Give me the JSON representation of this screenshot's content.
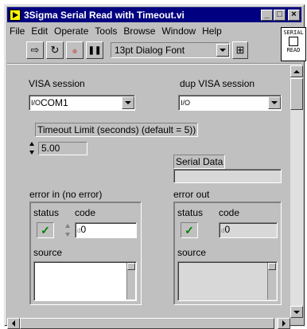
{
  "window": {
    "title": "3Sigma Serial Read with Timeout.vi",
    "min_glyph": "_",
    "max_glyph": "□",
    "close_glyph": "×"
  },
  "menu": [
    "File",
    "Edit",
    "Operate",
    "Tools",
    "Browse",
    "Window",
    "Help"
  ],
  "toolbar": {
    "run_icon": "⇨",
    "run_cont_icon": "↻",
    "abort_icon": "●",
    "pause_icon": "❚❚",
    "font": "13pt Dialog Font",
    "align_icon": "⊞"
  },
  "connector": {
    "line1": "SERIAL",
    "line2": "READ"
  },
  "controls": {
    "visa_session": {
      "label": "VISA session",
      "icon": "I/O",
      "value": "COM1"
    },
    "dup_visa": {
      "label": "dup VISA session",
      "icon": "I/O",
      "value": ""
    },
    "timeout": {
      "label": "Timeout Limit (seconds) (default = 5))",
      "value": "5.00"
    },
    "serial_data": {
      "label": "Serial Data",
      "value": ""
    },
    "error_in": {
      "label": "error in (no error)",
      "status_label": "status",
      "status_glyph": "✓",
      "code_label": "code",
      "code_value": "0",
      "code_prefix": "d",
      "source_label": "source",
      "source_value": ""
    },
    "error_out": {
      "label": "error out",
      "status_label": "status",
      "status_glyph": "✓",
      "code_label": "code",
      "code_value": "0",
      "code_prefix": "d",
      "source_label": "source",
      "source_value": ""
    }
  },
  "colors": {
    "titlebar": "#000080",
    "panel": "#c0c0c0",
    "led_on": "#008000"
  }
}
